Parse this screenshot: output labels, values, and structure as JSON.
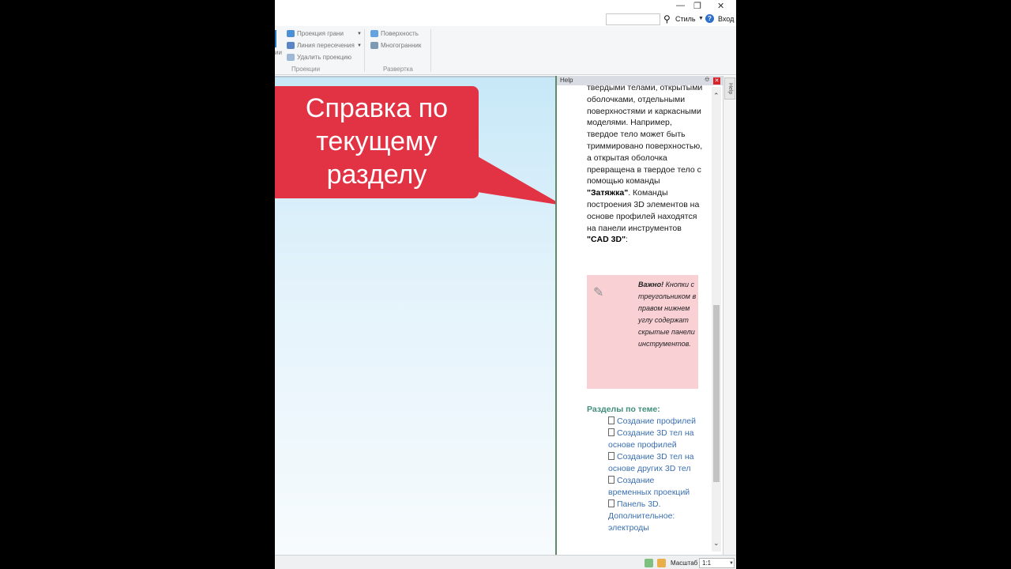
{
  "window": {
    "minimize_icon": "minimize-icon",
    "restore_icon": "restore-icon",
    "close_icon": "close-icon"
  },
  "header": {
    "style_label": "Стиль",
    "login_label": "Вход",
    "search_icon": "search-icon",
    "help_icon": "help-icon",
    "help_glyph": "?"
  },
  "ribbon": {
    "cut_label": "ии",
    "projection_group": {
      "label": "Проекции",
      "items": [
        "Проекция грани",
        "Линия пересечения",
        "Удалить проекцию"
      ]
    },
    "unfold_group": {
      "label": "Развертка",
      "items": [
        "Поверхность",
        "Многогранник"
      ]
    }
  },
  "callout": {
    "text": "Справка по текущему разделу",
    "color": "#e23345"
  },
  "help_panel": {
    "title": "Help",
    "lines_before_bold": "твердыми телами, открытыми оболочками, отдельными поверхностями и каркасными моделями. Например, твердое тело может быть триммировано поверхностью, а открытая оболочка превращена в твердое тело с помощью команды ",
    "bold_command": "\"Затяжка\"",
    "lines_after_bold": ". Команды построения 3D элементов на основе профилей находятся на панели инструментов ",
    "bold_toolbar": "\"CAD 3D\"",
    "colon": ":",
    "note": {
      "icon": "edit-icon",
      "bold": "Важно!",
      "text": " Кнопки с треугольником в правом нижнем углу содержат скрытые панели инструментов.",
      "background": "#f9d0d4"
    },
    "related_heading": "Разделы по теме:",
    "related_links": [
      "Создание профилей",
      "Создание 3D тел на основе профилей",
      "Создание 3D тел на основе других 3D тел",
      "Создание временных проекций",
      "Панель 3D. Дополнительное: электроды"
    ]
  },
  "side_tab": {
    "label": "Help"
  },
  "status_bar": {
    "scale_label": "Масштаб",
    "scale_value": "1:1"
  }
}
